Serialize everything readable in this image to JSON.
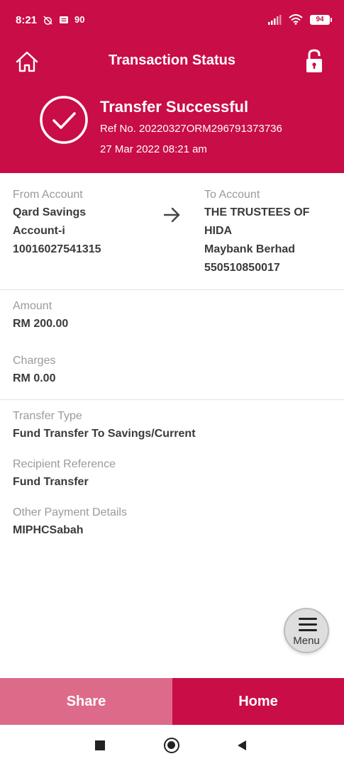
{
  "status_bar": {
    "time": "8:21",
    "icon_text_1": "90",
    "battery": "94",
    "icons": [
      "alarm-off-icon",
      "message-icon",
      "signal-icon",
      "wifi-icon",
      "battery-icon"
    ]
  },
  "header": {
    "title": "Transaction Status",
    "status": "Transfer Successful",
    "ref_no": "Ref No. 20220327ORM296791373736",
    "date_time": "27 Mar 2022 08:21 am",
    "accent_color": "#c90d47"
  },
  "from_account": {
    "label": "From Account",
    "line1": "Qard Savings",
    "line2": "Account-i",
    "line3": "10016027541315"
  },
  "to_account": {
    "label": "To Account",
    "line1": "THE TRUSTEES OF",
    "line2": "HIDA",
    "line3": "Maybank Berhad",
    "line4": "550510850017"
  },
  "amount": {
    "label": "Amount",
    "value": "RM 200.00"
  },
  "charges": {
    "label": "Charges",
    "value": "RM 0.00"
  },
  "transfer_type": {
    "label": "Transfer Type",
    "value": "Fund Transfer To Savings/Current"
  },
  "recipient_reference": {
    "label": "Recipient Reference",
    "value": "Fund Transfer"
  },
  "other_payment_details": {
    "label": "Other Payment Details",
    "value": "MIPHCSabah"
  },
  "menu": {
    "label": "Menu"
  },
  "actions": {
    "share": "Share",
    "home": "Home"
  }
}
